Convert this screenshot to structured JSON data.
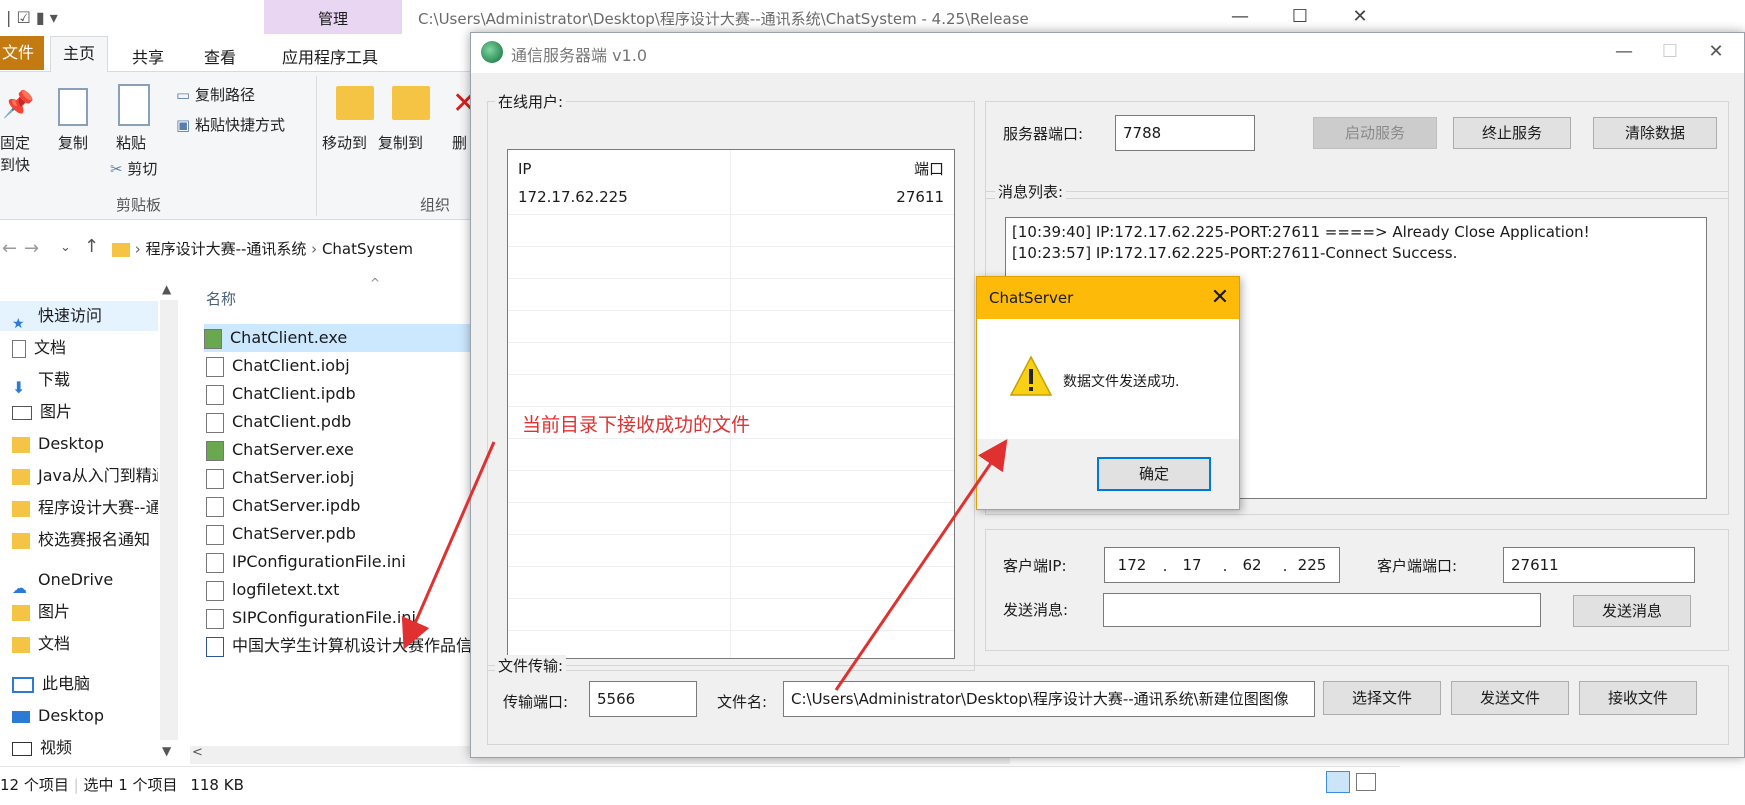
{
  "explorer": {
    "title": "C:\\Users\\Administrator\\Desktop\\程序设计大赛--通讯系统\\ChatSystem - 4.25\\Release",
    "manage_tab": "管理",
    "ribbon_tabs": {
      "file": "文件",
      "home": "主页",
      "share": "共享",
      "view": "查看",
      "app_tools": "应用程序工具"
    },
    "ribbon": {
      "pin_quick_access": "固定到快速访问",
      "copy": "复制",
      "paste": "粘贴",
      "copy_path": "复制路径",
      "paste_shortcut": "粘贴快捷方式",
      "cut": "剪切",
      "clipboard_group": "剪贴板",
      "move_to": "移动到",
      "copy_to": "复制到",
      "delete": "删",
      "organize_group": "组织"
    },
    "breadcrumb": {
      "part1": "程序设计大赛--通讯系统",
      "part2": "ChatSystem"
    },
    "column_name": "名称",
    "nav": [
      {
        "label": "快速访问",
        "icon": "star-icon"
      },
      {
        "label": "文档",
        "icon": "document-icon"
      },
      {
        "label": "下载",
        "icon": "download-icon"
      },
      {
        "label": "图片",
        "icon": "picture-icon"
      },
      {
        "label": "Desktop",
        "icon": "folder-icon"
      },
      {
        "label": "Java从入门到精通",
        "icon": "folder-icon"
      },
      {
        "label": "程序设计大赛--通讯系统",
        "icon": "folder-icon"
      },
      {
        "label": "校选赛报名通知",
        "icon": "folder-icon"
      },
      {
        "label": "OneDrive",
        "icon": "cloud-icon"
      },
      {
        "label": "图片",
        "icon": "folder-icon"
      },
      {
        "label": "文档",
        "icon": "folder-icon"
      },
      {
        "label": "此电脑",
        "icon": "computer-icon"
      },
      {
        "label": "Desktop",
        "icon": "desktop-icon"
      },
      {
        "label": "视频",
        "icon": "video-icon"
      }
    ],
    "files": [
      "ChatClient.exe",
      "ChatClient.iobj",
      "ChatClient.ipdb",
      "ChatClient.pdb",
      "ChatServer.exe",
      "ChatServer.iobj",
      "ChatServer.ipdb",
      "ChatServer.pdb",
      "IPConfigurationFile.ini",
      "logfiletext.txt",
      "SIPConfigurationFile.ini",
      "中国大学生计算机设计大赛作品信息"
    ],
    "status": {
      "count": "12 个项目",
      "selected": "选中 1 个项目",
      "size": "118 KB"
    }
  },
  "server": {
    "title": "通信服务器端 v1.0",
    "online_users_label": "在线用户:",
    "user_columns": {
      "ip": "IP",
      "port": "端口"
    },
    "users": [
      {
        "ip": "172.17.62.225",
        "port": "27611"
      }
    ],
    "server_port_label": "服务器端口:",
    "server_port": "7788",
    "start_button": "启动服务",
    "stop_button": "终止服务",
    "clear_button": "清除数据",
    "message_list_label": "消息列表:",
    "messages": [
      "[10:39:40] IP:172.17.62.225-PORT:27611 ====> Already Close Application!",
      "[10:23:57] IP:172.17.62.225-PORT:27611-Connect Success."
    ],
    "client_ip_label": "客户端IP:",
    "client_ip": [
      "172",
      "17",
      "62",
      "225"
    ],
    "client_port_label": "客户端端口:",
    "client_port": "27611",
    "send_msg_label": "发送消息:",
    "send_msg_value": "",
    "send_msg_button": "发送消息",
    "file_transfer_label": "文件传输:",
    "transfer_port_label": "传输端口:",
    "transfer_port": "5566",
    "file_name_label": "文件名:",
    "file_name": "C:\\Users\\Administrator\\Desktop\\程序设计大赛--通讯系统\\新建位图图像",
    "choose_file_button": "选择文件",
    "send_file_button": "发送文件",
    "receive_file_button": "接收文件"
  },
  "dialog": {
    "title": "ChatServer",
    "message": "数据文件发送成功.",
    "ok_button": "确定"
  },
  "annotation": "当前目录下接收成功的文件",
  "colors": {
    "dialog_title": "#fdba09",
    "annotation": "#e03030",
    "manage_tab": "#e9d6f2",
    "file_tab": "#c37a10"
  }
}
